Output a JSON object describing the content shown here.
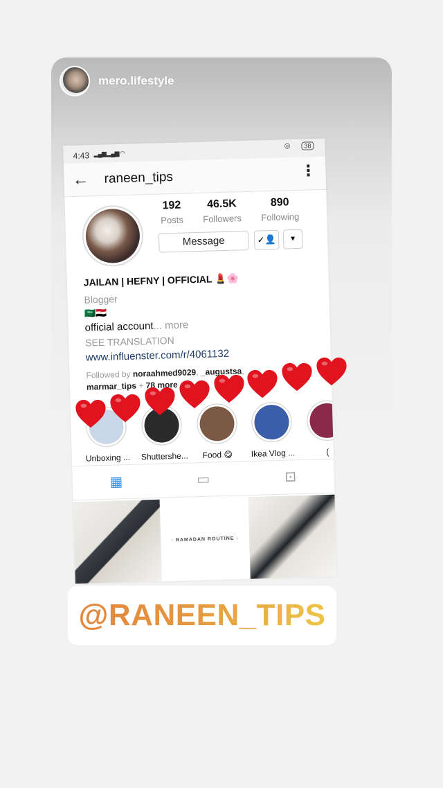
{
  "story": {
    "username": "mero.lifestyle",
    "avatar_icon": "user-avatar"
  },
  "screenshot": {
    "status": {
      "time": "4:43",
      "battery": "38"
    },
    "header": {
      "username": "raneen_tips"
    },
    "stats": {
      "posts": {
        "value": "192",
        "label": "Posts"
      },
      "followers": {
        "value": "46.5K",
        "label": "Followers"
      },
      "following": {
        "value": "890",
        "label": "Following"
      }
    },
    "buttons": {
      "message": "Message"
    },
    "bio": {
      "name": "JAILAN | HEFNY | OFFICIAL 💄🌸",
      "category": "Blogger",
      "flags": "🇸🇦🇪🇬",
      "text": "official account",
      "more": "... more",
      "translation": "SEE TRANSLATION",
      "link": "www.influenster.com/r/4061132",
      "followed_prefix": "Followed by ",
      "followed_users": "noraahmed9029",
      "followed_sep": ", ",
      "followed_users2": "_augustsa",
      "followed_sep2": ",",
      "followed_users3": "marmar_tips",
      "followed_suffix": " + ",
      "followed_more": "78 more"
    },
    "highlights": [
      {
        "label": "Unboxing ...",
        "color": "#c9d6e8"
      },
      {
        "label": "Shuttershe...",
        "color": "#2a2a2a"
      },
      {
        "label": "Food 😋",
        "color": "#7a5a44"
      },
      {
        "label": "Ikea Vlog ...",
        "color": "#3a5ea8"
      },
      {
        "label": "(",
        "color": "#8a2a4a"
      }
    ],
    "grid": {
      "cell2_text": "· RAMADAN ROUTINE ·"
    }
  },
  "mention": {
    "text": "@RANEEN_TIPS",
    "gradient_start": "#e2843c",
    "gradient_end": "#eec94a"
  },
  "stickers": {
    "heart_color": "#e0131f",
    "heart_count": 8
  }
}
